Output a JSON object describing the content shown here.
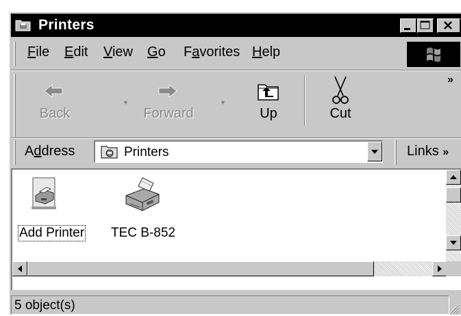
{
  "window": {
    "title": "Printers"
  },
  "menu": {
    "items": [
      {
        "key": "F",
        "rest": "ile"
      },
      {
        "key": "E",
        "rest": "dit"
      },
      {
        "key": "V",
        "rest": "iew"
      },
      {
        "key": "G",
        "rest": "o"
      },
      {
        "pre": "F",
        "key": "a",
        "rest": "vorites"
      },
      {
        "key": "H",
        "rest": "elp"
      }
    ]
  },
  "toolbar": {
    "back_label": "Back",
    "forward_label": "Forward",
    "up_label": "Up",
    "cut_label": "Cut",
    "chevron": "»"
  },
  "address": {
    "label_pre": "A",
    "label_key": "d",
    "label_rest": "dress",
    "value": "Printers",
    "links_label": "Links",
    "links_chevron": "»"
  },
  "items": [
    {
      "label": "Add Printer",
      "icon": "add-printer-icon",
      "selected": true
    },
    {
      "label": "TEC B-852",
      "icon": "printer-icon",
      "selected": false
    }
  ],
  "status": {
    "text": "5 object(s)"
  }
}
